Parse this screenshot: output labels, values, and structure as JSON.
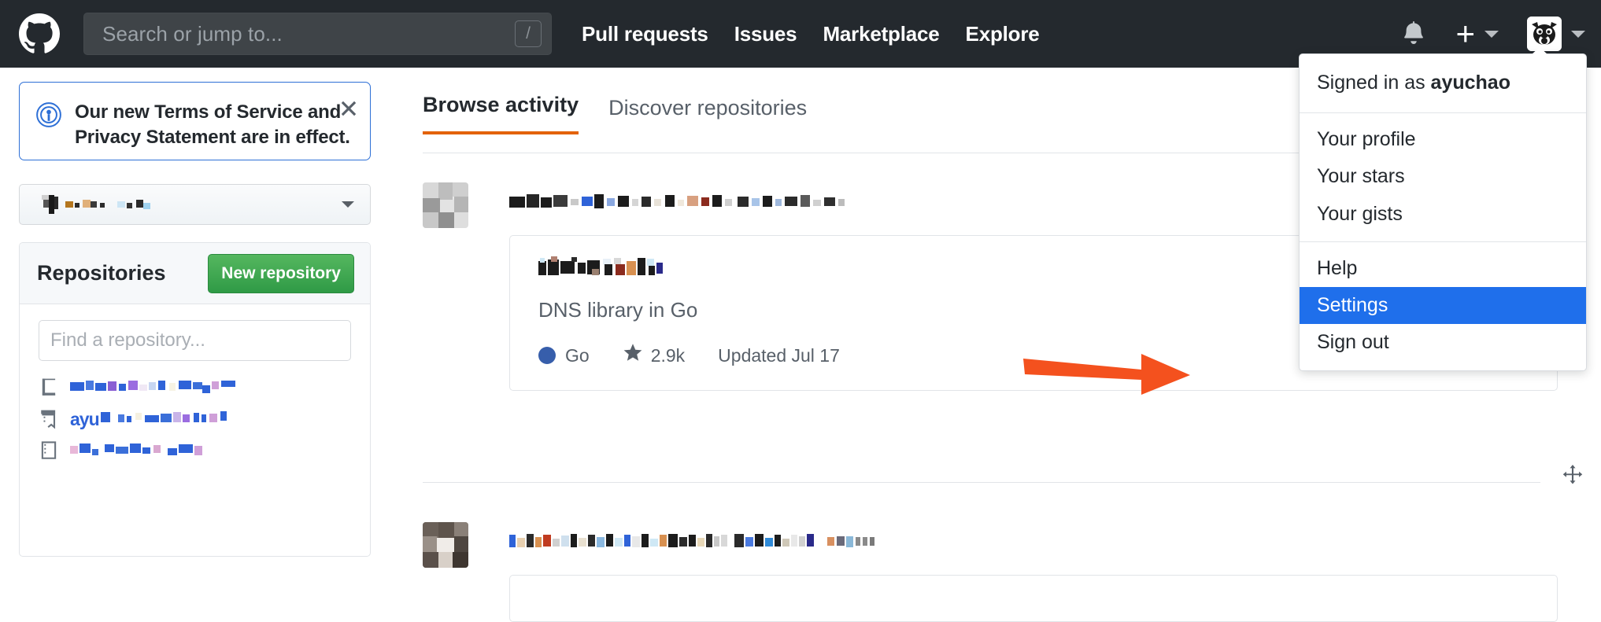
{
  "header": {
    "logo_icon": "github-mark-icon",
    "search": {
      "placeholder": "Search or jump to...",
      "shortcut_key": "/"
    },
    "nav": [
      {
        "label": "Pull requests"
      },
      {
        "label": "Issues"
      },
      {
        "label": "Marketplace"
      },
      {
        "label": "Explore"
      }
    ],
    "notifications_icon": "bell-icon",
    "create_new_icon": "plus-icon",
    "create_new_caret_icon": "chevron-down-icon",
    "avatar_icon": "user-avatar-bulldog",
    "avatar_caret_icon": "chevron-down-icon",
    "background_color": "#24292e"
  },
  "profile_dropdown": {
    "signed_in_prefix": "Signed in as ",
    "username": "ayuchao",
    "items": [
      {
        "label": "Your profile",
        "selected": false
      },
      {
        "label": "Your stars",
        "selected": false
      },
      {
        "label": "Your gists",
        "selected": false
      },
      {
        "label": "Help",
        "selected": false
      },
      {
        "label": "Settings",
        "selected": true
      },
      {
        "label": "Sign out",
        "selected": false
      }
    ],
    "highlight_color": "#1f6feb"
  },
  "sidebar": {
    "tos_banner": {
      "icon": "megaphone-broadcast-icon",
      "line1": "Our new Terms of Service and",
      "line2": "Privacy Statement are in effect.",
      "close_icon": "close-x-icon",
      "border_color": "#2d6fd6"
    },
    "org_selector": {
      "value": "",
      "caret_icon": "chevron-down-icon"
    },
    "repositories_panel": {
      "title": "Repositories",
      "new_repo_button": "New repository",
      "find_placeholder": "Find a repository...",
      "items": [
        {
          "icon": "repo-icon",
          "name": ""
        },
        {
          "icon": "repo-forked-icon",
          "name": "ayu"
        },
        {
          "icon": "repo-icon",
          "name": ""
        }
      ]
    }
  },
  "main": {
    "tabs": [
      {
        "label": "Browse activity",
        "active": true
      },
      {
        "label": "Discover repositories",
        "active": false
      }
    ],
    "feed": [
      {
        "actor": "",
        "headline": "",
        "repo": {
          "name": "",
          "description": "DNS library in Go",
          "language": "Go",
          "language_color": "#375eab",
          "stars": "2.9k",
          "updated": "Updated Jul 17",
          "star_icon": "star-icon"
        }
      },
      {
        "actor": "",
        "headline": "",
        "move_handle_icon": "move-drag-icon"
      }
    ]
  },
  "annotation": {
    "arrow_icon": "arrow-right-annotation",
    "color": "#f4511e"
  }
}
